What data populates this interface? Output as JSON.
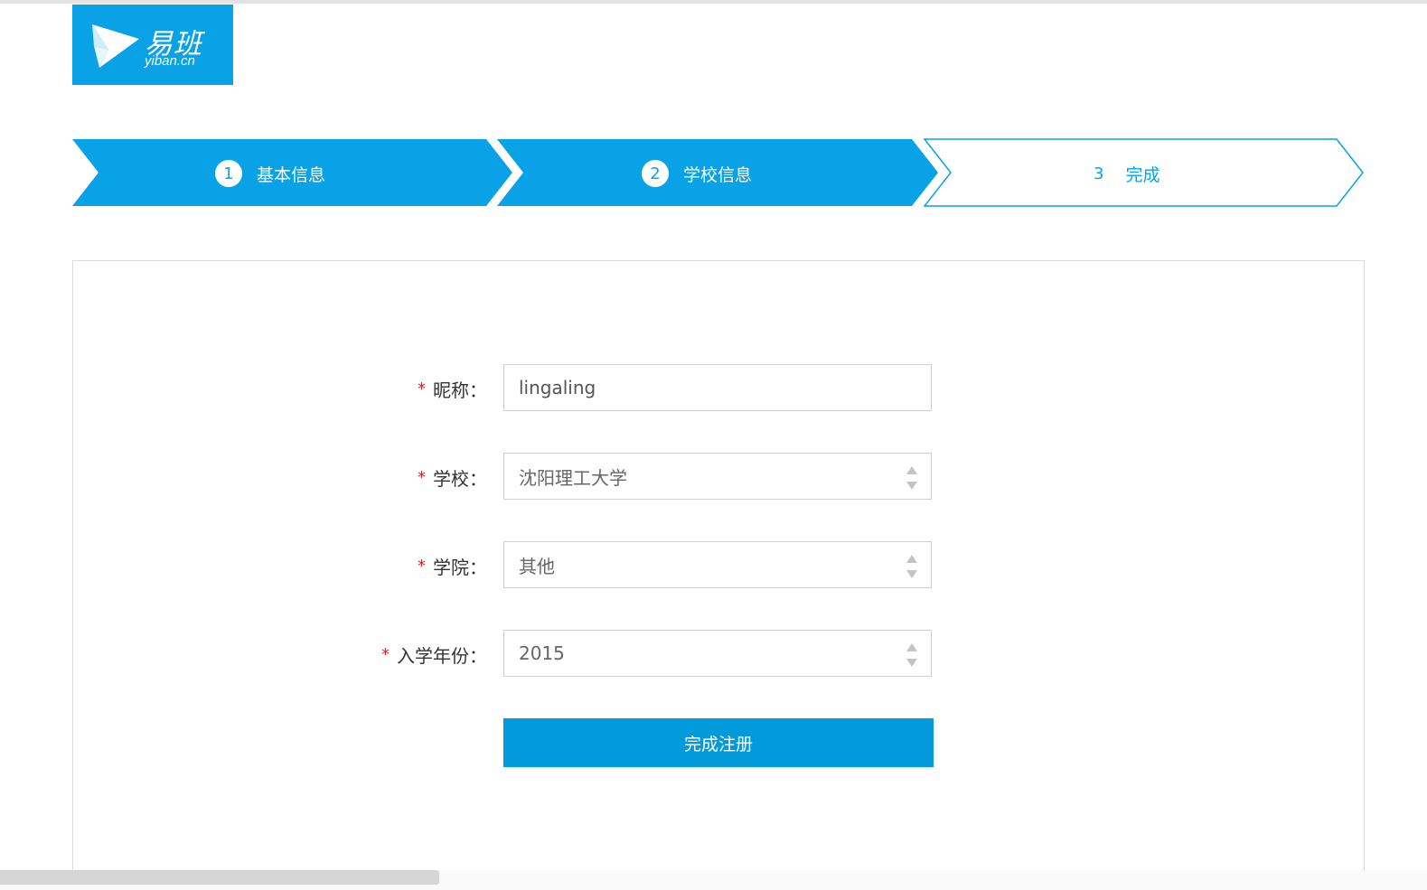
{
  "logo": {
    "text_cn": "易班",
    "text_en": "yiban.cn"
  },
  "steps": [
    {
      "number": "1",
      "label": "基本信息",
      "state": "completed"
    },
    {
      "number": "2",
      "label": "学校信息",
      "state": "current"
    },
    {
      "number": "3",
      "label": "完成",
      "state": "pending"
    }
  ],
  "form": {
    "required_mark": "*",
    "nickname": {
      "label": "昵称：",
      "value": "lingaling"
    },
    "school": {
      "label": "学校：",
      "value": "沈阳理工大学"
    },
    "college": {
      "label": "学院：",
      "value": "其他"
    },
    "year": {
      "label": "入学年份：",
      "value": "2015"
    },
    "submit_label": "完成注册"
  },
  "colors": {
    "accent": "#09a2e6",
    "button": "#039adb",
    "required": "#e02020"
  }
}
